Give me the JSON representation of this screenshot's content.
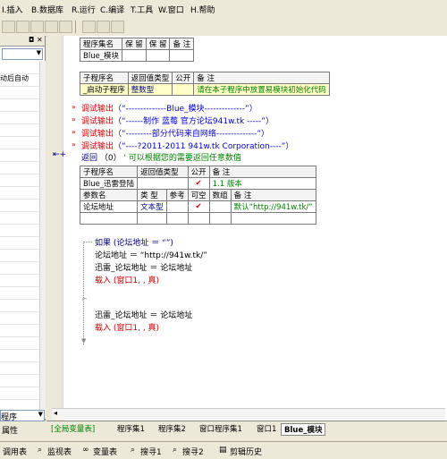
{
  "menubar": {
    "items": [
      "I.插入",
      "B.数据库",
      "R.运行",
      "C.编译",
      "T.工具",
      "W.窗口",
      "H.帮助"
    ]
  },
  "left_panel": {
    "row_text": "动后自动",
    "bottom_combo": "程序",
    "props_tab": "属性"
  },
  "assembly_table": {
    "headers": [
      "程序集名",
      "保 留",
      "保 留",
      "备 注"
    ],
    "row": [
      "Blue_模块",
      "",
      "",
      ""
    ]
  },
  "sub1_table": {
    "headers": [
      "子程序名",
      "返回值类型",
      "公开",
      "备 注"
    ],
    "row": [
      "_启动子程序",
      "整数型",
      "",
      "请在本子程序中放置易模块初始化代码"
    ]
  },
  "debug_lines": [
    {
      "fn": "调试输出",
      "arg": "（“--------------Blue_模块--------------”）"
    },
    {
      "fn": "调试输出",
      "arg": "（“------制作 蓝莓  官方论坛941w.tk -----”）"
    },
    {
      "fn": "调试输出",
      "arg": "（“---------部分代码来自网络--------------”）"
    },
    {
      "fn": "调试输出",
      "arg": "（“----?2011-2011 941w.tk Corporation----”）"
    }
  ],
  "return_line": {
    "kw": "返回",
    "arg": "（0）",
    "comment": "' 可以根据您的需要返回任意数值"
  },
  "sub2_table": {
    "headers": [
      "子程序名",
      "返回值类型",
      "公开",
      "备 注"
    ],
    "row": [
      "Blue_迅雷登陆",
      "",
      "✔",
      "1.1 版本"
    ],
    "param_headers": [
      "参数名",
      "类 型",
      "参考",
      "可空",
      "数组",
      "备 注"
    ],
    "param_row": [
      "论坛地址",
      "文本型",
      "",
      "✔",
      "",
      "默认“http://941w.tk/”"
    ]
  },
  "code": {
    "if_line": "如果 (论坛地址 ＝ “”)",
    "assign1": "论坛地址 ＝ “http://941w.tk/”",
    "assign2": "迅雷_论坛地址 ＝ 论坛地址",
    "load1": "载入 (窗口1, , 真)",
    "assign3": "迅雷_论坛地址 ＝ 论坛地址",
    "load2": "载入 (窗口1, , 真)"
  },
  "tabs": [
    "[全局变量表]",
    "程序集1",
    "程序集2",
    "窗口程序集1",
    "窗口1",
    "Blue_模块"
  ],
  "statusbar": {
    "items": [
      "调用表",
      "监视表",
      "变量表",
      "搜寻1",
      "搜寻2",
      "剪辑历史"
    ]
  },
  "colors": {
    "keyword": "#cc0000",
    "string": "#0000cc",
    "comment": "#008000",
    "type": "#000080"
  }
}
